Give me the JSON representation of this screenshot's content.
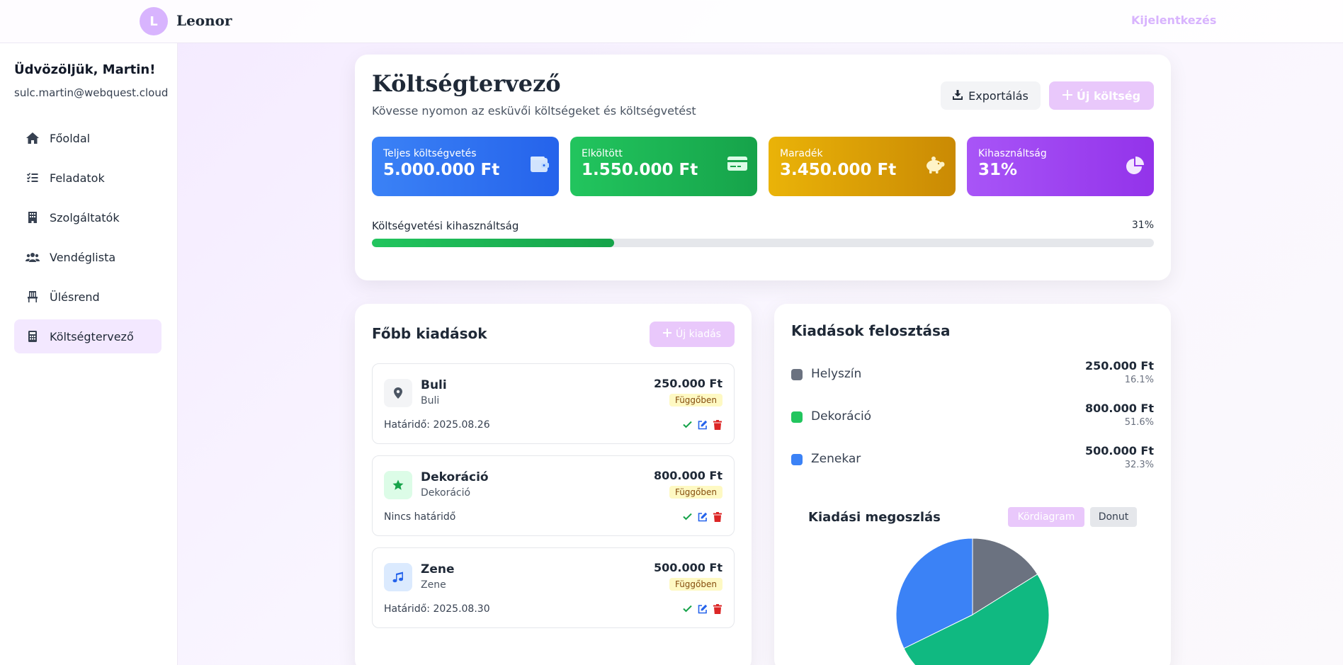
{
  "app": {
    "avatar_letter": "L",
    "name": "Leonor",
    "logout_label": "Kijelentkezés"
  },
  "user": {
    "welcome": "Üdvözöljük, Martin!",
    "email": "sulc.martin@webquest.cloud"
  },
  "nav": {
    "items": [
      {
        "label": "Főoldal",
        "icon": "home-icon"
      },
      {
        "label": "Feladatok",
        "icon": "tasks-icon"
      },
      {
        "label": "Szolgáltatók",
        "icon": "building-icon"
      },
      {
        "label": "Vendéglista",
        "icon": "users-icon"
      },
      {
        "label": "Ülésrend",
        "icon": "chair-icon"
      },
      {
        "label": "Költségtervező",
        "icon": "calculator-icon",
        "active": true
      }
    ]
  },
  "page": {
    "title": "Költségtervező",
    "subtitle": "Kövesse nyomon az esküvői költségeket és költségvetést",
    "export_label": "Exportálás",
    "new_cost_label": "Új költség"
  },
  "stats": [
    {
      "label": "Teljes költségvetés",
      "value": "5.000.000 Ft",
      "icon": "wallet-icon"
    },
    {
      "label": "Elköltött",
      "value": "1.550.000 Ft",
      "icon": "credit-card-icon"
    },
    {
      "label": "Maradék",
      "value": "3.450.000 Ft",
      "icon": "piggy-bank-icon"
    },
    {
      "label": "Kihasználtság",
      "value": "31%",
      "icon": "pie-chart-icon"
    }
  ],
  "utilization": {
    "label": "Költségvetési kihasználtság",
    "percent_label": "31%",
    "percent": 31
  },
  "expenses": {
    "title": "Főbb kiadások",
    "add_label": "Új kiadás",
    "items": [
      {
        "name": "Buli",
        "category": "Buli",
        "amount": "250.000 Ft",
        "status": "Függőben",
        "due": "Határidő: 2025.08.26",
        "icon": "map-pin-icon",
        "icon_bg": "#f3f4f6",
        "icon_color": "#4b5563"
      },
      {
        "name": "Dekoráció",
        "category": "Dekoráció",
        "amount": "800.000 Ft",
        "status": "Függőben",
        "due": "Nincs határidő",
        "icon": "star-icon",
        "icon_bg": "#dcfce7",
        "icon_color": "#16a34a"
      },
      {
        "name": "Zene",
        "category": "Zene",
        "amount": "500.000 Ft",
        "status": "Függőben",
        "due": "Határidő: 2025.08.30",
        "icon": "music-icon",
        "icon_bg": "#dbeafe",
        "icon_color": "#2563eb"
      }
    ]
  },
  "distribution": {
    "title": "Kiadások felosztása",
    "items": [
      {
        "name": "Helyszín",
        "amount": "250.000 Ft",
        "percent": "16.1%",
        "color": "#6b7280"
      },
      {
        "name": "Dekoráció",
        "amount": "800.000 Ft",
        "percent": "51.6%",
        "color": "#22c55e"
      },
      {
        "name": "Zenekar",
        "amount": "500.000 Ft",
        "percent": "32.3%",
        "color": "#3b82f6"
      }
    ],
    "chart_title": "Kiadási megoszlás",
    "tab_pie": "Kördiagram",
    "tab_donut": "Donut"
  },
  "chart_data": {
    "type": "pie",
    "categories": [
      "Helyszín",
      "Dekoráció",
      "Zenekar"
    ],
    "values": [
      250000,
      800000,
      500000
    ],
    "colors": [
      "#6b7280",
      "#10b981",
      "#3b82f6"
    ]
  }
}
